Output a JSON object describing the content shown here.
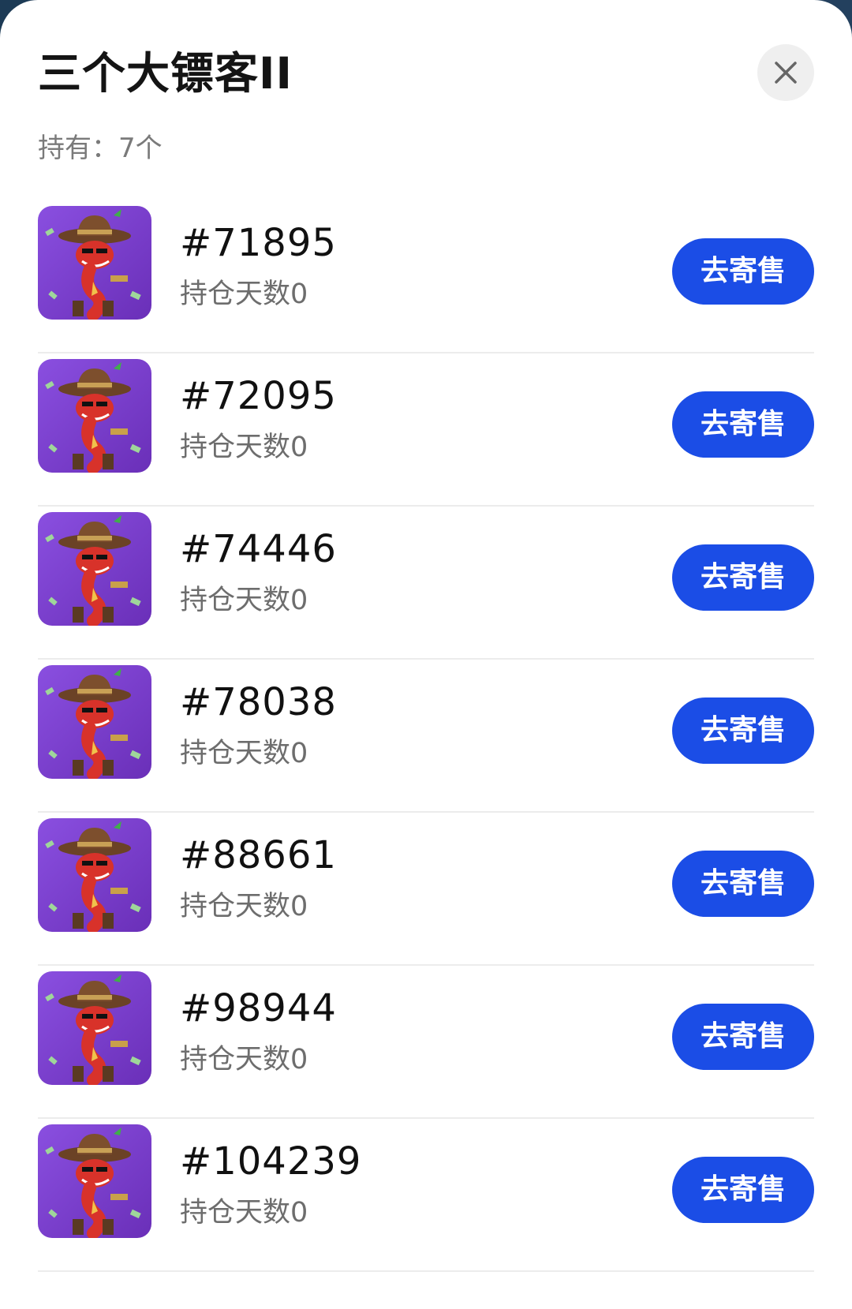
{
  "sheet": {
    "title": "三个大镖客II",
    "close_icon": "close-icon",
    "holding_label": "持有：7个"
  },
  "colors": {
    "accent": "#1b4de6",
    "title_text": "#141414",
    "secondary_text": "#7a7a7a",
    "divider": "#ececec",
    "thumb_background": "#7a3fcc"
  },
  "items": [
    {
      "id": "#71895",
      "days": "持仓天数0",
      "action": "去寄售",
      "thumbnail": "cowboy-snake-nft-icon"
    },
    {
      "id": "#72095",
      "days": "持仓天数0",
      "action": "去寄售",
      "thumbnail": "cowboy-snake-nft-icon"
    },
    {
      "id": "#74446",
      "days": "持仓天数0",
      "action": "去寄售",
      "thumbnail": "cowboy-snake-nft-icon"
    },
    {
      "id": "#78038",
      "days": "持仓天数0",
      "action": "去寄售",
      "thumbnail": "cowboy-snake-nft-icon"
    },
    {
      "id": "#88661",
      "days": "持仓天数0",
      "action": "去寄售",
      "thumbnail": "cowboy-snake-nft-icon"
    },
    {
      "id": "#98944",
      "days": "持仓天数0",
      "action": "去寄售",
      "thumbnail": "cowboy-snake-nft-icon"
    },
    {
      "id": "#104239",
      "days": "持仓天数0",
      "action": "去寄售",
      "thumbnail": "cowboy-snake-nft-icon"
    }
  ]
}
